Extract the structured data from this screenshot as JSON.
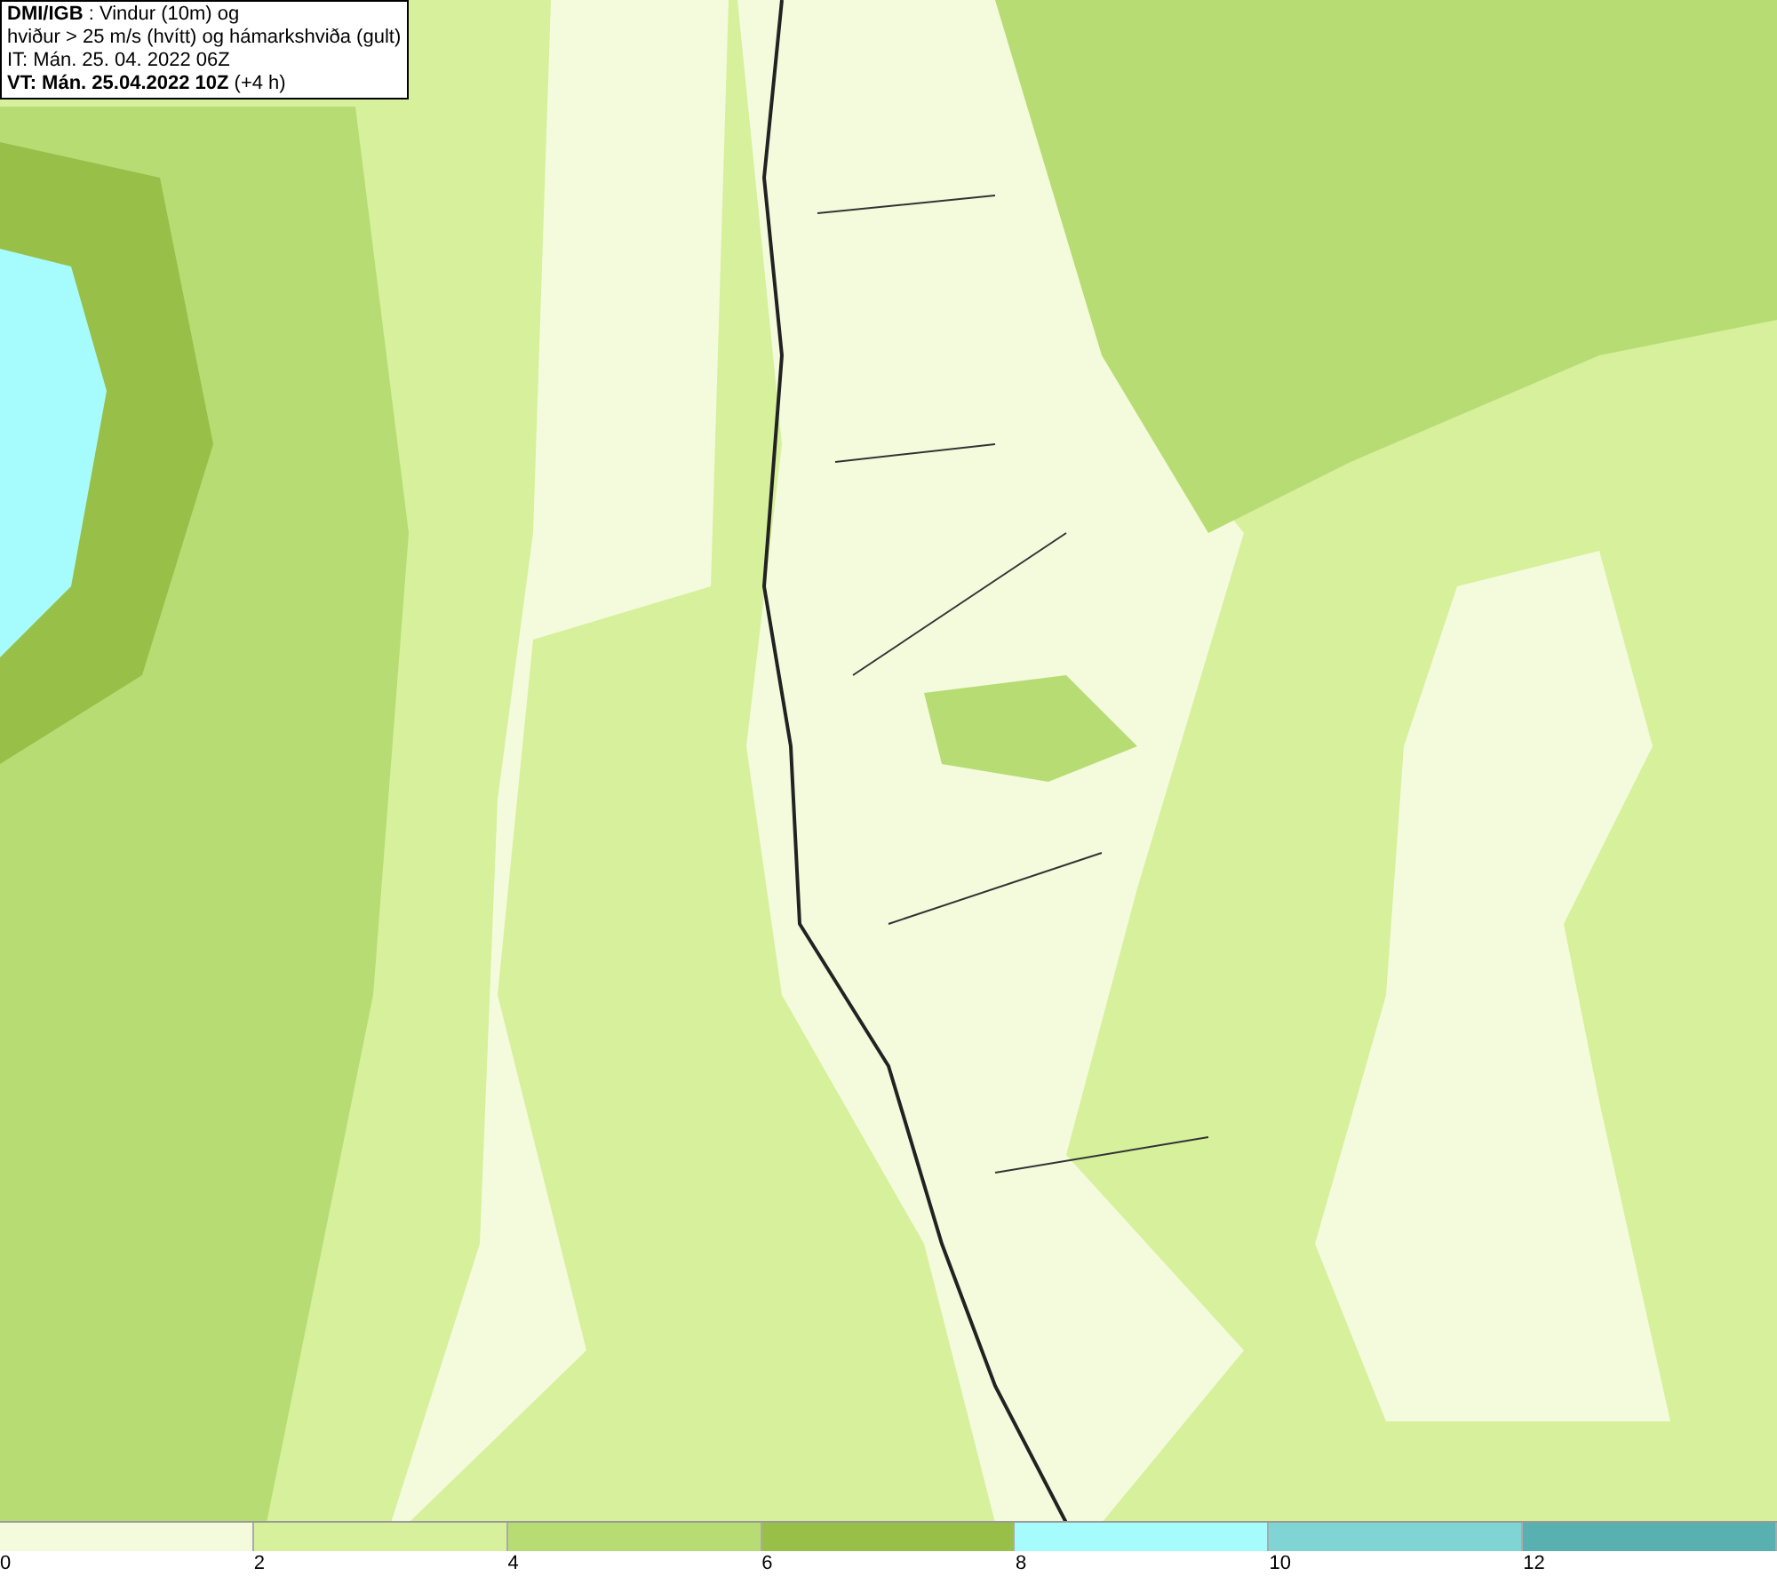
{
  "title_box": {
    "lines": [
      "**DMI/IGB** : Vindur (10m) og",
      "hviður > 25 m/s (hvítt) og hámarkshviða (gult)",
      "IT: Mán. 25. 04. 2022 06Z",
      "**VT: Mán. 25.04.2022 10Z** (+4 h)"
    ]
  },
  "legend": [
    {
      "label": "0",
      "color": "#f4fbdc"
    },
    {
      "label": "2",
      "color": "#d6f09c"
    },
    {
      "label": "4",
      "color": "#b8dc74"
    },
    {
      "label": "6",
      "color": "#98c048"
    },
    {
      "label": "8",
      "color": "#a6fcfc"
    },
    {
      "label": "10",
      "color": "#80d4d4"
    },
    {
      "label": "12",
      "color": "#58b0b0"
    }
  ]
}
